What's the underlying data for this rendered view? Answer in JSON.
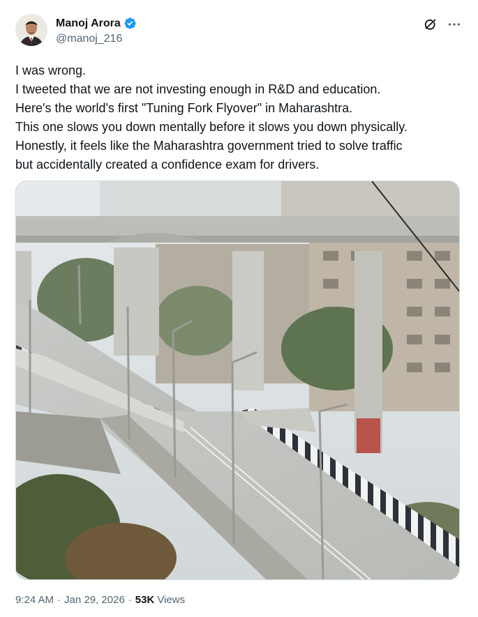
{
  "author": {
    "display_name": "Manoj Arora",
    "handle": "@manoj_216",
    "verified": true,
    "verified_color": "#1d9bf0"
  },
  "header_icons": [
    "grok-icon",
    "more-icon"
  ],
  "tweet": {
    "lines": [
      "I was wrong.",
      "I tweeted that we are not investing enough in R&D and education.",
      "Here's the world's first \"Tuning Fork Flyover\" in Maharashtra.",
      "This one slows you down mentally before it slows you down physically.",
      "Honestly, it feels like the Maharashtra government tried to solve traffic",
      "but accidentally created a confidence exam for drivers."
    ]
  },
  "media": {
    "type": "photo"
  },
  "meta": {
    "time": "9:24 AM",
    "date": "Jan 29, 2026",
    "separator": "·",
    "views_count": "53K",
    "views_label": "Views"
  },
  "colors": {
    "text_primary": "#0f1419",
    "text_secondary": "#536471",
    "border": "#cfd9de"
  }
}
